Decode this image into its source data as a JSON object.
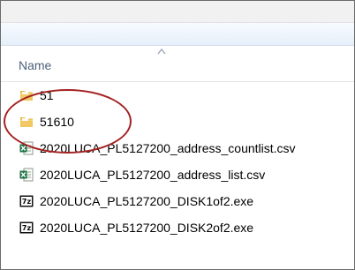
{
  "header": {
    "column_name": "Name"
  },
  "files": [
    {
      "name": "51",
      "icon": "folder-icon"
    },
    {
      "name": "51610",
      "icon": "folder-icon"
    },
    {
      "name": "2020LUCA_PL5127200_address_countlist.csv",
      "icon": "excel-csv-icon"
    },
    {
      "name": "2020LUCA_PL5127200_address_list.csv",
      "icon": "excel-csv-icon"
    },
    {
      "name": "2020LUCA_PL5127200_DISK1of2.exe",
      "icon": "7z-icon"
    },
    {
      "name": "2020LUCA_PL5127200_DISK2of2.exe",
      "icon": "7z-icon"
    }
  ],
  "colors": {
    "annotation_circle": "#a42222",
    "header_text": "#4c607a",
    "toolbar_gradient": "#e6effa"
  }
}
